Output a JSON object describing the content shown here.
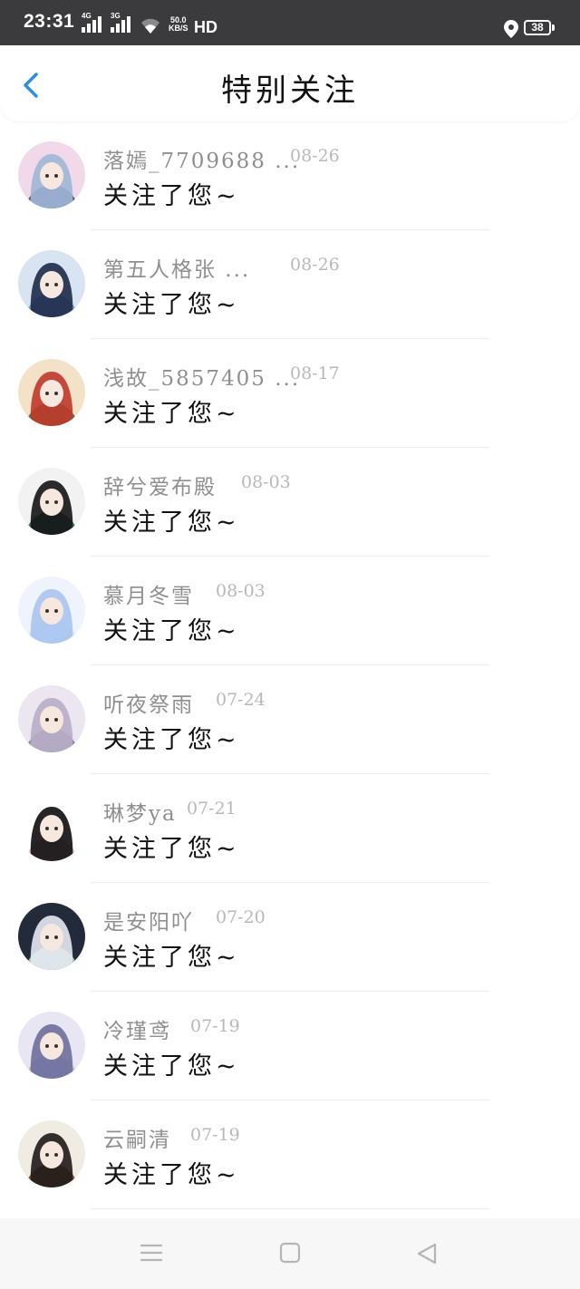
{
  "status_bar": {
    "time": "23:31",
    "signal1_label": "4G",
    "signal2_label": "3G",
    "speed_value": "50.0",
    "speed_unit": "KB/S",
    "hd_label": "HD",
    "battery": "38"
  },
  "header": {
    "title": "特别关注",
    "back_icon": "chevron-left-icon",
    "accent_color": "#2b8ee8"
  },
  "items": [
    {
      "name": "落嫣_7709688 ...",
      "date": "08-26",
      "message": "关注了您~",
      "avatar_colors": [
        "#f2d9e9",
        "#9fb6d6",
        "#5a5a7a"
      ]
    },
    {
      "name": "第五人格张 ...",
      "date": "08-26",
      "message": "关注了您~",
      "avatar_colors": [
        "#d8e4f2",
        "#1e2a48",
        "#7aa0d0"
      ]
    },
    {
      "name": "浅故_5857405 ...",
      "date": "08-17",
      "message": "关注了您~",
      "avatar_colors": [
        "#f3e2c8",
        "#c0392b",
        "#4a7d3a"
      ]
    },
    {
      "name": "辞兮爱布殿",
      "date": "08-03",
      "message": "关注了您~",
      "avatar_colors": [
        "#f2f2f2",
        "#141414",
        "#3c7f6d"
      ]
    },
    {
      "name": "慕月冬雪",
      "date": "08-03",
      "message": "关注了您~",
      "avatar_colors": [
        "#eef3fc",
        "#a9c4ef",
        "#d8e6ff"
      ]
    },
    {
      "name": "听夜祭雨",
      "date": "07-24",
      "message": "关注了您~",
      "avatar_colors": [
        "#ece6f0",
        "#b8aec8",
        "#8a8198"
      ]
    },
    {
      "name": "琳梦ya",
      "date": "07-21",
      "message": "关注了您~",
      "avatar_colors": [
        "#ffffff",
        "#0d0d0d",
        "#f3c0cc"
      ]
    },
    {
      "name": "是安阳吖",
      "date": "07-20",
      "message": "关注了您~",
      "avatar_colors": [
        "#232a3a",
        "#e6e9f3",
        "#9cc4a6"
      ]
    },
    {
      "name": "冷瑾鸢",
      "date": "07-19",
      "message": "关注了您~",
      "avatar_colors": [
        "#e8e6f2",
        "#6d6f9c",
        "#c7b6d7"
      ]
    },
    {
      "name": "云嗣清",
      "date": "07-19",
      "message": "关注了您~",
      "avatar_colors": [
        "#f1ece3",
        "#1f1a18",
        "#8a5a3c"
      ]
    }
  ],
  "nav_bar": {
    "menu_icon": "menu-icon",
    "home_icon": "home-square-icon",
    "back_icon": "back-triangle-icon"
  }
}
